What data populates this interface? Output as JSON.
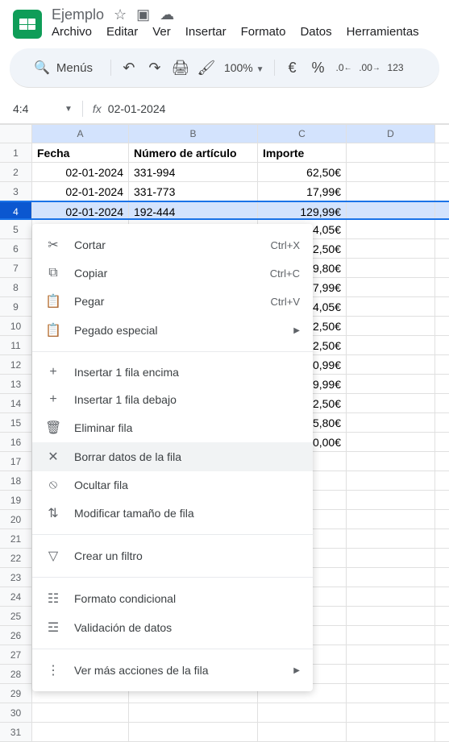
{
  "doc": {
    "title": "Ejemplo"
  },
  "menu": [
    "Archivo",
    "Editar",
    "Ver",
    "Insertar",
    "Formato",
    "Datos",
    "Herramientas"
  ],
  "toolbar": {
    "search": "Menús",
    "zoom": "100%",
    "currency": "€",
    "percent": "%",
    "dec_dec": ".0",
    "inc_dec": ".00",
    "num123": "123"
  },
  "name_box": "4:4",
  "formula": "02-01-2024",
  "columns": [
    "A",
    "B",
    "C",
    "D"
  ],
  "headers": {
    "a": "Fecha",
    "b": "Número de artículo",
    "c": "Importe"
  },
  "rows": [
    {
      "n": 1
    },
    {
      "n": 2,
      "a": "02-01-2024",
      "b": "331-994",
      "c": "62,50€"
    },
    {
      "n": 3,
      "a": "02-01-2024",
      "b": "331-773",
      "c": "17,99€"
    },
    {
      "n": 4,
      "a": "02-01-2024",
      "b": "192-444",
      "c": "129,99€",
      "selected": true
    },
    {
      "n": 5,
      "c": "4,05€"
    },
    {
      "n": 6,
      "c": "2,50€"
    },
    {
      "n": 7,
      "c": "9,80€"
    },
    {
      "n": 8,
      "c": "7,99€"
    },
    {
      "n": 9,
      "c": "4,05€"
    },
    {
      "n": 10,
      "c": "2,50€"
    },
    {
      "n": 11,
      "c": "2,50€"
    },
    {
      "n": 12,
      "c": "0,99€"
    },
    {
      "n": 13,
      "c": "9,99€"
    },
    {
      "n": 14,
      "c": "2,50€"
    },
    {
      "n": 15,
      "c": "5,80€"
    },
    {
      "n": 16,
      "c": "0,00€"
    },
    {
      "n": 17
    },
    {
      "n": 18
    },
    {
      "n": 19
    },
    {
      "n": 20
    },
    {
      "n": 21
    },
    {
      "n": 22
    },
    {
      "n": 23
    },
    {
      "n": 24
    },
    {
      "n": 25
    },
    {
      "n": 26
    },
    {
      "n": 27
    },
    {
      "n": 28
    },
    {
      "n": 29
    },
    {
      "n": 30
    },
    {
      "n": 31
    }
  ],
  "ctx": {
    "cut": "Cortar",
    "cut_k": "Ctrl+X",
    "copy": "Copiar",
    "copy_k": "Ctrl+C",
    "paste": "Pegar",
    "paste_k": "Ctrl+V",
    "paste_special": "Pegado especial",
    "insert_above": "Insertar 1 fila encima",
    "insert_below": "Insertar 1 fila debajo",
    "delete_row": "Eliminar fila",
    "clear_row": "Borrar datos de la fila",
    "hide_row": "Ocultar fila",
    "resize_row": "Modificar tamaño de fila",
    "create_filter": "Crear un filtro",
    "cond_format": "Formato condicional",
    "data_validation": "Validación de datos",
    "more_actions": "Ver más acciones de la fila"
  }
}
